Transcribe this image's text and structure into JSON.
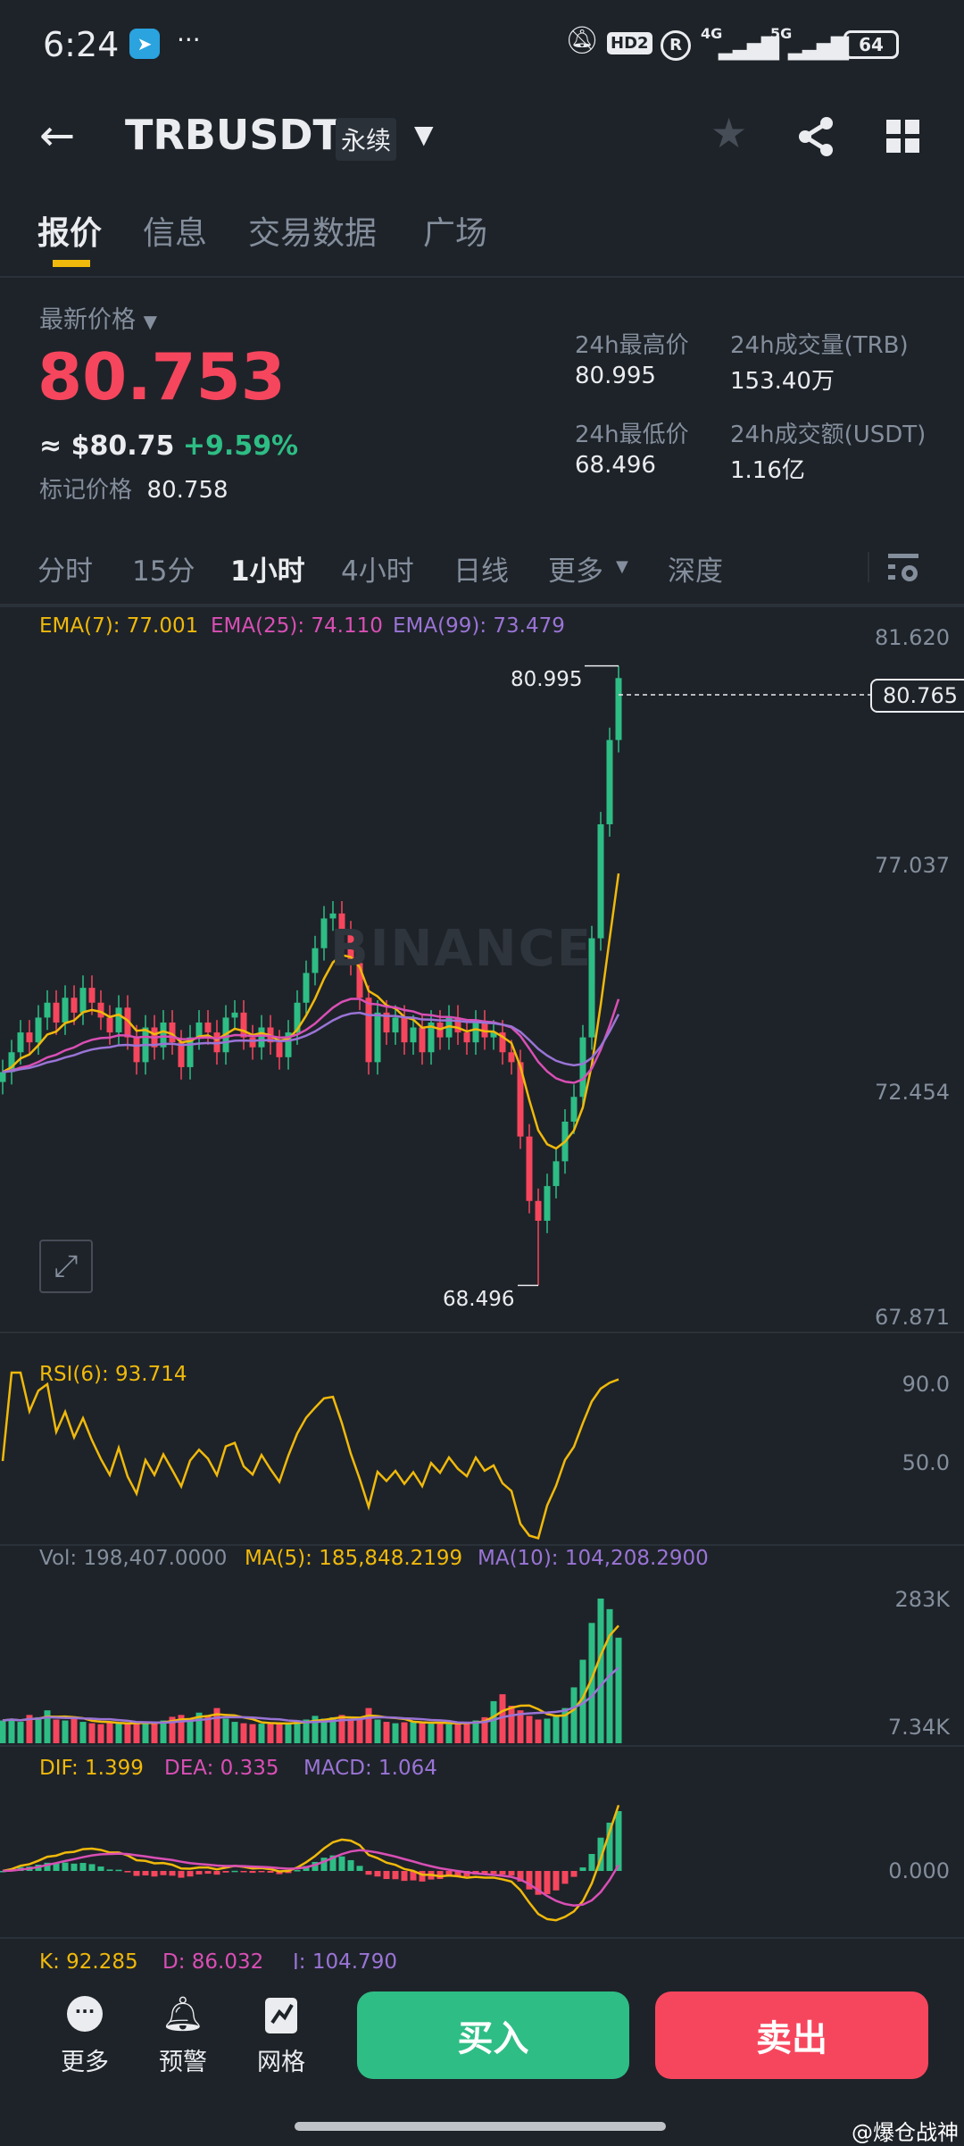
{
  "status": {
    "time": "6:24",
    "hd": "HD2",
    "net1": "4G",
    "net2": "5G",
    "battery": "64"
  },
  "header": {
    "symbol": "TRBUSDT",
    "contract_type": "永续"
  },
  "tabs": [
    "报价",
    "信息",
    "交易数据",
    "广场"
  ],
  "price": {
    "label": "最新价格",
    "last": "80.753",
    "usd": "≈ $80.75",
    "change": "+9.59%",
    "mark_label": "标记价格",
    "mark": "80.758"
  },
  "stats": {
    "high_label": "24h最高价",
    "high": "80.995",
    "low_label": "24h最低价",
    "low": "68.496",
    "vol_label": "24h成交量(TRB)",
    "vol": "153.40万",
    "amt_label": "24h成交额(USDT)",
    "amt": "1.16亿"
  },
  "intervals": [
    "分时",
    "15分",
    "1小时",
    "4小时",
    "日线",
    "更多",
    "深度"
  ],
  "active_interval": 2,
  "ema": {
    "ema7": "EMA(7): 77.001",
    "ema25": "EMA(25): 74.110",
    "ema99": "EMA(99): 73.479"
  },
  "price_axis": [
    "81.620",
    "77.037",
    "72.454",
    "67.871"
  ],
  "current_price_tag": "80.765",
  "high_marker": "80.995",
  "low_marker": "68.496",
  "watermark": "BINANCE",
  "rsi": {
    "label": "RSI(6): 93.714",
    "axis": [
      "90.0",
      "50.0"
    ]
  },
  "vol": {
    "label": "Vol: 198,407.0000",
    "ma5": "MA(5): 185,848.2199",
    "ma10": "MA(10): 104,208.2900",
    "axis": [
      "283K",
      "7.34K"
    ]
  },
  "macd": {
    "dif": "DIF: 1.399",
    "dea": "DEA: 0.335",
    "macd": "MACD: 1.064",
    "axis": "0.000"
  },
  "kdj": {
    "k": "K: 92.285",
    "d": "D: 86.032",
    "j": "J: 104.790"
  },
  "bottom": {
    "more": "更多",
    "alert": "预警",
    "grid": "网格",
    "buy": "买入",
    "sell": "卖出"
  },
  "credit": "@爆仓战神",
  "colors": {
    "bg": "#1e2329",
    "up": "#2ebd85",
    "down": "#f6465d",
    "accent": "#f0b90b",
    "ema25": "#d94fb5",
    "ema99": "#9a74d6"
  },
  "chart_data": {
    "type": "candlestick",
    "price_range": [
      67.871,
      81.62
    ],
    "high": 80.995,
    "low": 68.496,
    "closes": [
      72.8,
      73.2,
      73.6,
      73.4,
      73.9,
      74.2,
      73.8,
      74.3,
      74.0,
      74.5,
      74.2,
      73.9,
      73.6,
      74.1,
      73.5,
      73.0,
      73.7,
      73.3,
      73.8,
      73.4,
      72.9,
      73.5,
      73.8,
      73.6,
      73.2,
      73.9,
      74.0,
      73.5,
      73.3,
      73.7,
      73.4,
      73.1,
      73.6,
      74.2,
      74.8,
      75.3,
      75.9,
      76.0,
      75.6,
      75.0,
      74.3,
      73.0,
      74.0,
      73.6,
      73.9,
      73.4,
      73.7,
      73.2,
      73.8,
      73.5,
      73.9,
      73.6,
      73.4,
      73.8,
      73.5,
      73.6,
      73.2,
      73.0,
      71.5,
      70.2,
      69.8,
      70.5,
      71.0,
      71.8,
      72.3,
      73.5,
      75.5,
      77.8,
      79.5,
      80.75
    ],
    "volumes": [
      18,
      22,
      15,
      30,
      25,
      40,
      20,
      18,
      22,
      15,
      12,
      10,
      14,
      12,
      11,
      13,
      15,
      12,
      18,
      26,
      30,
      20,
      35,
      28,
      45,
      22,
      15,
      12,
      10,
      11,
      14,
      12,
      10,
      16,
      20,
      28,
      22,
      25,
      30,
      18,
      25,
      45,
      20,
      15,
      12,
      14,
      16,
      13,
      11,
      12,
      10,
      13,
      15,
      18,
      25,
      60,
      75,
      50,
      40,
      28,
      20,
      22,
      30,
      45,
      90,
      150,
      230,
      283,
      260,
      198
    ]
  }
}
